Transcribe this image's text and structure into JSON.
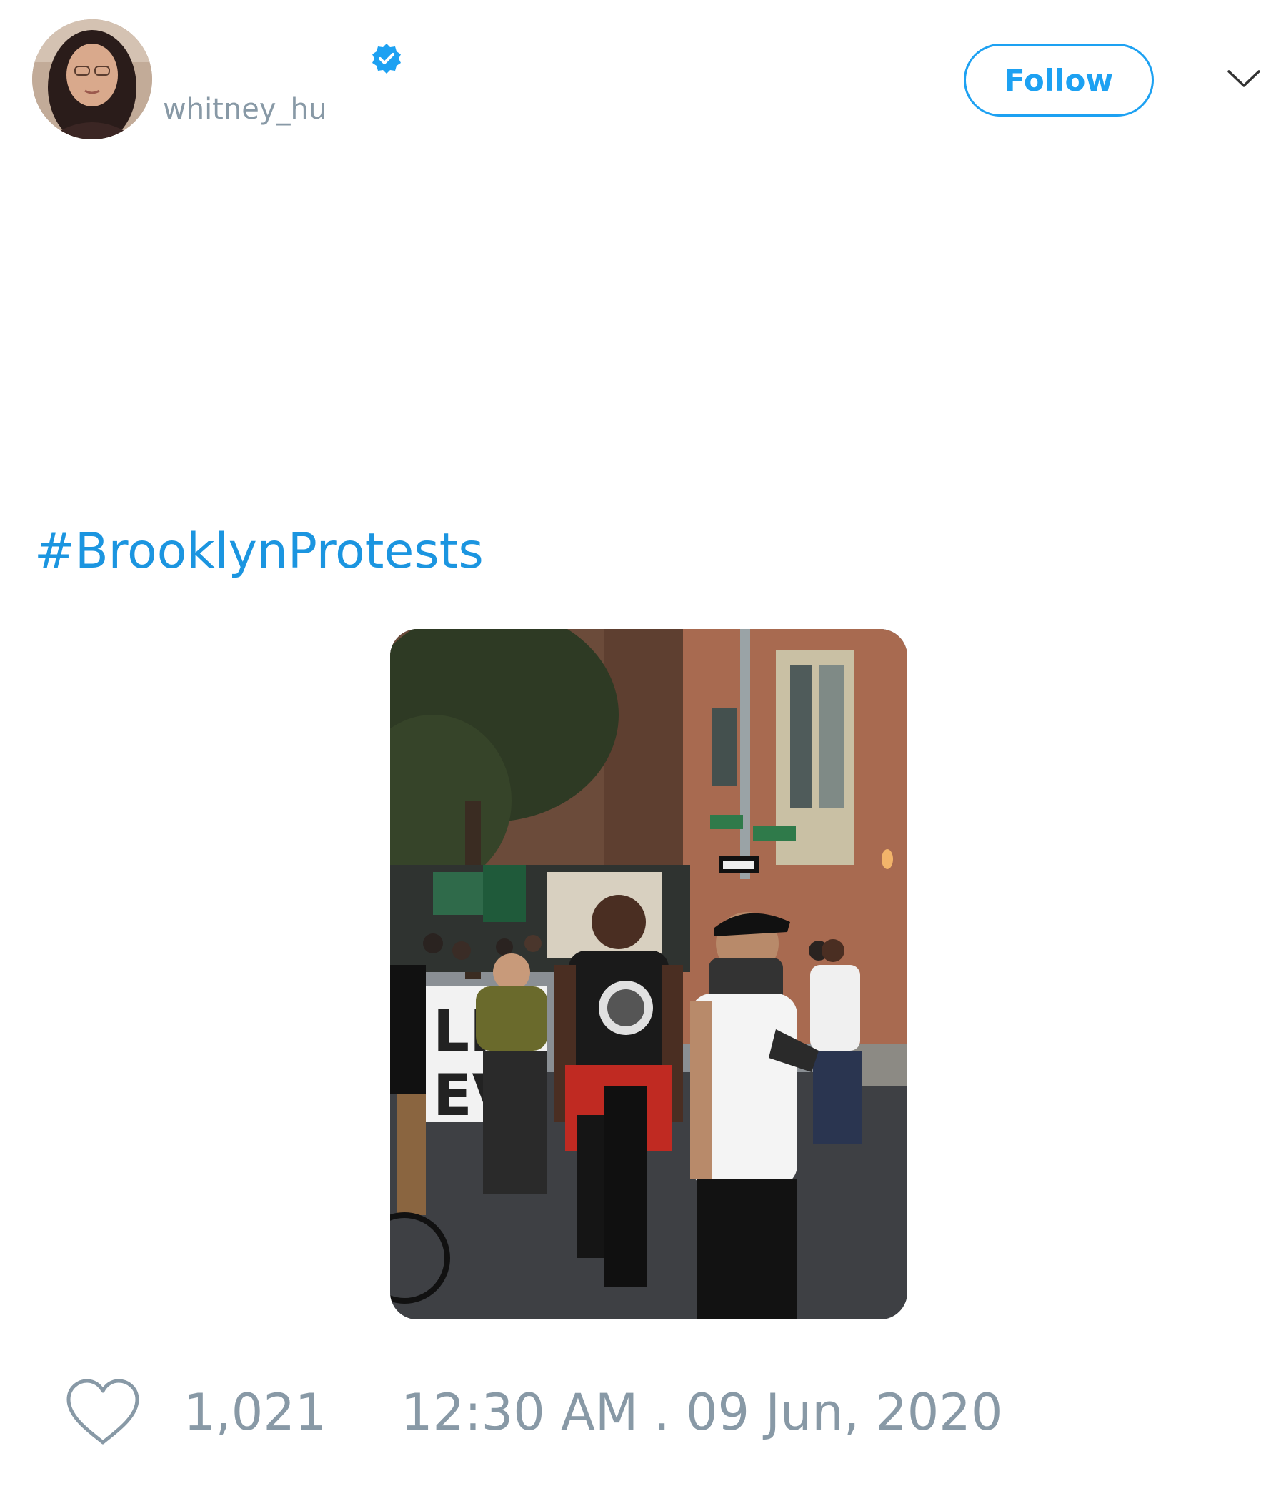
{
  "tweet": {
    "username": "whitney_hu",
    "follow_label": "Follow",
    "hashtag": "#BrooklynProtests",
    "like_count": "1,021",
    "timestamp": "12:30 AM . 09 Jun, 2020"
  },
  "icons": {
    "verified": "verified-badge-icon",
    "menu": "chevron-down-icon",
    "like": "heart-outline-icon"
  },
  "colors": {
    "brand_blue": "#1da1f2",
    "link_blue": "#1b95e0",
    "muted_gray": "#8899a6"
  }
}
